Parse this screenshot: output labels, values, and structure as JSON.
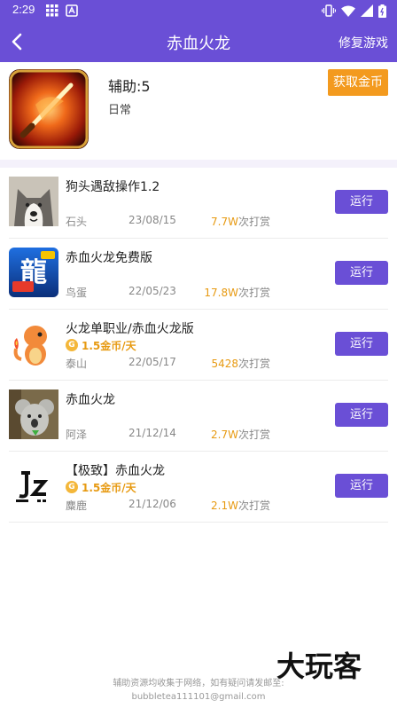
{
  "status_bar": {
    "time": "2:29"
  },
  "app_bar": {
    "title": "赤血火龙",
    "action": "修复游戏"
  },
  "game": {
    "helper_count": "辅助:5",
    "category": "日常",
    "get_coins_button": "获取金币"
  },
  "scripts": [
    {
      "name": "狗头遇敌操作1.2",
      "author": "石头",
      "date": "23/08/15",
      "tip_count": "7.7W",
      "tip_suffix": "次打赏",
      "run_label": "运行",
      "price": "",
      "thumb_icon": "husky-icon"
    },
    {
      "name": "赤血火龙免费版",
      "author": "鸟蛋",
      "date": "22/05/23",
      "tip_count": "17.8W",
      "tip_suffix": "次打赏",
      "run_label": "运行",
      "price": "",
      "thumb_icon": "dragon-logo-icon"
    },
    {
      "name": "火龙单职业/赤血火龙版",
      "author": "泰山",
      "date": "22/05/17",
      "tip_count": "5428",
      "tip_suffix": "次打赏",
      "run_label": "运行",
      "price": "1.5金币/天",
      "thumb_icon": "charmander-icon"
    },
    {
      "name": "赤血火龙",
      "author": "阿泽",
      "date": "21/12/14",
      "tip_count": "2.7W",
      "tip_suffix": "次打赏",
      "run_label": "运行",
      "price": "",
      "thumb_icon": "koala-icon"
    },
    {
      "name": "【极致】赤血火龙",
      "author": "麋鹿",
      "date": "21/12/06",
      "tip_count": "2.1W",
      "tip_suffix": "次打赏",
      "run_label": "运行",
      "price": "1.5金币/天",
      "thumb_icon": "jz-logo-icon"
    }
  ],
  "coin_glyph": "G",
  "footer": {
    "line1": "辅助资源均收集于网络，如有疑问请发邮至:",
    "line2": "bubbletea111101@gmail.com"
  },
  "watermark": "大玩客",
  "colors": {
    "primary": "#6a4fd6",
    "accent": "#f39a1e",
    "tip": "#e79a12"
  }
}
